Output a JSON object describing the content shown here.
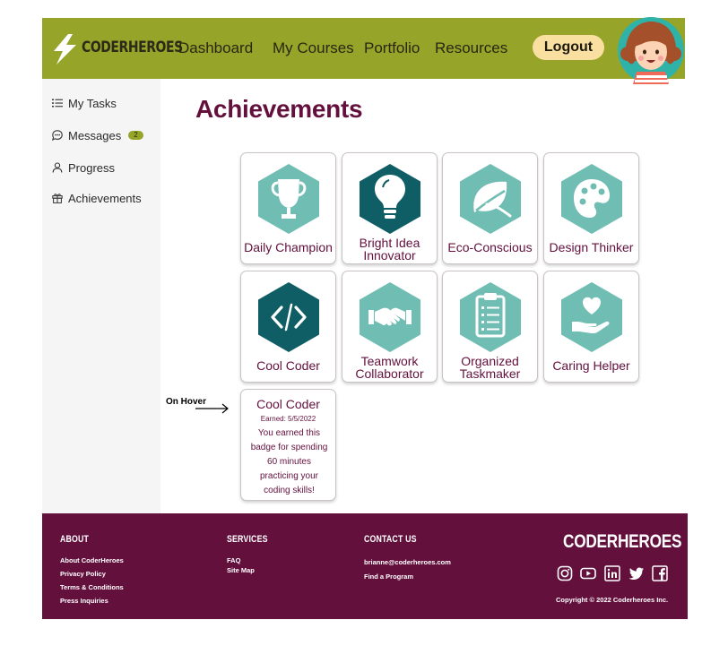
{
  "header": {
    "brand": "CODERHEROES",
    "nav": [
      "Dashboard",
      "My Courses",
      "Portfolio",
      "Resources"
    ],
    "logout_label": "Logout"
  },
  "sidebar": {
    "items": [
      {
        "label": "My Tasks",
        "icon": "list-icon"
      },
      {
        "label": "Messages",
        "icon": "chat-icon",
        "badge": "2"
      },
      {
        "label": "Progress",
        "icon": "user-icon"
      },
      {
        "label": "Achievements",
        "icon": "gift-icon"
      }
    ]
  },
  "main": {
    "title": "Achievements",
    "badges": [
      {
        "label": "Daily Champion",
        "icon": "trophy-icon"
      },
      {
        "label": "Bright Idea Innovator",
        "icon": "lightbulb-icon"
      },
      {
        "label": "Eco-Conscious",
        "icon": "leaf-icon"
      },
      {
        "label": "Design Thinker",
        "icon": "palette-icon"
      },
      {
        "label": "Cool Coder",
        "icon": "code-icon"
      },
      {
        "label": "Teamwork Collaborator",
        "icon": "handshake-icon"
      },
      {
        "label": "Organized Taskmaker",
        "icon": "clipboard-icon"
      },
      {
        "label": "Caring Helper",
        "icon": "heart-hand-icon"
      }
    ],
    "hover_label": "On Hover",
    "hover_card": {
      "title": "Cool Coder",
      "earned": "Earned: 5/5/2022",
      "description": "You earned this badge for spending 60 minutes practicing your coding skills!"
    }
  },
  "footer": {
    "about": {
      "heading": "ABOUT",
      "links": [
        "About CoderHeroes",
        "Privacy Policy",
        "Terms & Conditions",
        "Press Inquiries"
      ]
    },
    "services": {
      "heading": "SERVICES",
      "links": [
        "FAQ",
        "Site Map"
      ]
    },
    "contact": {
      "heading": "CONTACT US",
      "links": [
        "brianne@coderheroes.com",
        "Find a Program"
      ]
    },
    "brand": "CODERHEROES",
    "social": [
      "instagram-icon",
      "youtube-icon",
      "linkedin-icon",
      "twitter-icon",
      "facebook-icon"
    ],
    "copyright": "Copyright © 2022 Coderheroes Inc."
  },
  "colors": {
    "header_bg": "#97a42a",
    "accent": "#63103d",
    "badge_hex": "#6fbdb3",
    "badge_hex_dark": "#0f5e66",
    "logout_bg": "#fae0a0"
  }
}
